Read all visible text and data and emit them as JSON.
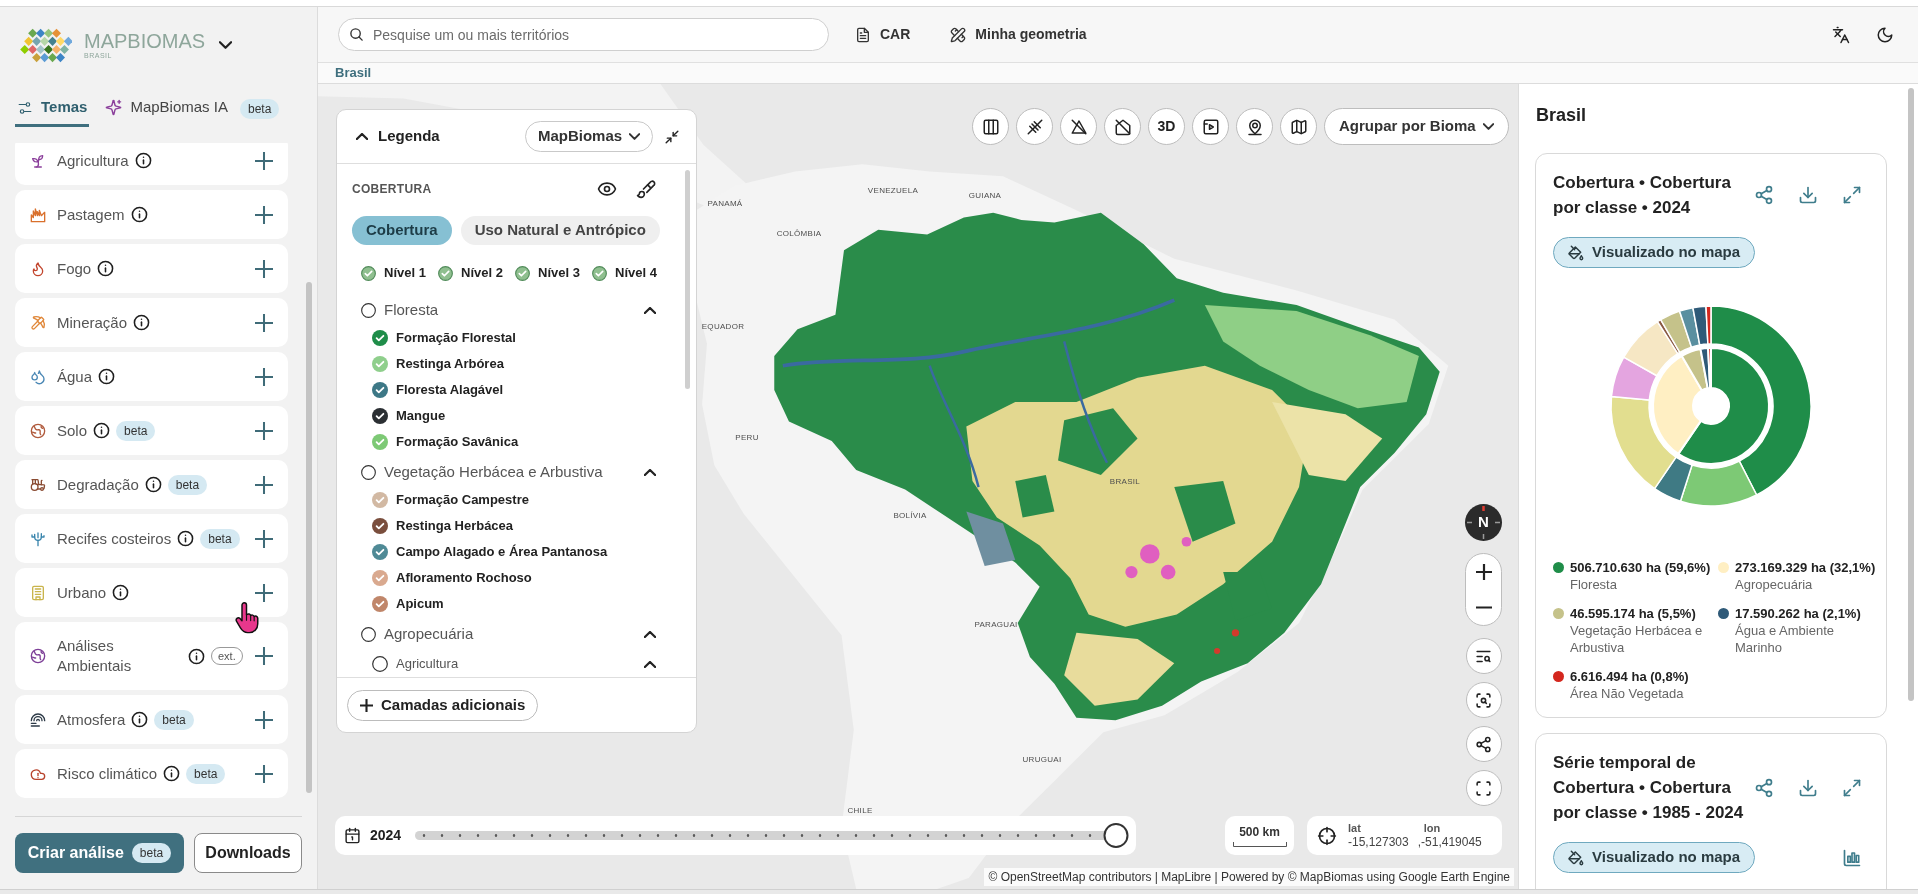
{
  "sidebar": {
    "logo": {
      "wordmark": "MAPBIOMAS",
      "country": "BRASIL"
    },
    "tabs": [
      {
        "label": "Temas",
        "selected": true
      },
      {
        "label": "MapBiomas IA",
        "selected": false,
        "badge": "beta"
      }
    ],
    "themes": [
      {
        "label": "Agricultura",
        "info": true
      },
      {
        "label": "Pastagem",
        "info": true
      },
      {
        "label": "Fogo",
        "info": true
      },
      {
        "label": "Mineração",
        "info": true
      },
      {
        "label": "Água",
        "info": true
      },
      {
        "label": "Solo",
        "info": true,
        "badge": {
          "kind": "filled",
          "text": "beta"
        }
      },
      {
        "label": "Degradação",
        "info": true,
        "badge": {
          "kind": "filled",
          "text": "beta"
        }
      },
      {
        "label": "Recifes costeiros",
        "info": true,
        "badge": {
          "kind": "filled",
          "text": "beta"
        }
      },
      {
        "label": "Urbano",
        "info": true
      },
      {
        "label": "Análises Ambientais",
        "info": true,
        "badge": {
          "kind": "outline",
          "text": "ext."
        }
      },
      {
        "label": "Atmosfera",
        "info": true,
        "badge": {
          "kind": "filled",
          "text": "beta"
        }
      },
      {
        "label": "Risco climático",
        "info": true,
        "badge": {
          "kind": "filled",
          "text": "beta"
        }
      }
    ],
    "actions": [
      {
        "kind": "primary",
        "label": "Criar análise",
        "badge": "beta"
      },
      {
        "kind": "secondary",
        "label": "Downloads"
      }
    ]
  },
  "topbar": {
    "search": {
      "placeholder": "Pesquise um ou mais territórios"
    },
    "links": [
      "CAR",
      "Minha geometria"
    ]
  },
  "breadcrumb": [
    "Brasil"
  ],
  "map": {
    "labels": [
      "PANAMÁ",
      "VENEZUELA",
      "GUIANA",
      "COLÔMBIA",
      "EQUADOR",
      "PERU",
      "BOLÍVIA",
      "BRASIL",
      "PARAGUAI",
      "URUGUAI",
      "CHILE"
    ],
    "legend": {
      "title": "Legenda",
      "expanded": true,
      "source": "MapBiomas",
      "section": "COBERTURA",
      "tabs": [
        {
          "label": "Cobertura",
          "selected": true
        },
        {
          "label": "Uso Natural e Antrópico",
          "selected": false
        }
      ],
      "levels": [
        {
          "label": "Nível 1",
          "checked": true
        },
        {
          "label": "Nível 2",
          "checked": true
        },
        {
          "label": "Nível 3",
          "checked": true
        },
        {
          "label": "Nível 4",
          "checked": true
        }
      ],
      "classes": [
        {
          "label": "Floresta",
          "checked": false,
          "expanded": true,
          "children": [
            {
              "label": "Formação Florestal",
              "checked": true,
              "color": "#1f8d49"
            },
            {
              "label": "Restinga Arbórea",
              "checked": true,
              "color": "#8fcf8c"
            },
            {
              "label": "Floresta Alagável",
              "checked": true,
              "color": "#3d7886"
            },
            {
              "label": "Mangue",
              "checked": true,
              "color": "#2b2f33"
            },
            {
              "label": "Formação Savânica",
              "checked": true,
              "color": "#7dc975"
            }
          ]
        },
        {
          "label": "Vegetação Herbácea e Arbustiva",
          "checked": false,
          "expanded": true,
          "children": [
            {
              "label": "Formação Campestre",
              "checked": true,
              "color": "#d2b9a3"
            },
            {
              "label": "Restinga Herbácea",
              "checked": true,
              "color": "#7a4e3d"
            },
            {
              "label": "Campo Alagado e Área Pantanosa",
              "checked": true,
              "color": "#4f8a96"
            },
            {
              "label": "Afloramento Rochoso",
              "checked": true,
              "color": "#d9a98f"
            },
            {
              "label": "Apicum",
              "checked": true,
              "color": "#c0866a"
            }
          ]
        },
        {
          "label": "Agropecuária",
          "checked": false,
          "expanded": true,
          "children": [
            {
              "label": "Agricultura",
              "checked": false,
              "expanded": true
            }
          ]
        }
      ],
      "add_button": "Camadas adicionais"
    },
    "toolbar": {
      "buttons": [
        {
          "kind": "icon"
        },
        {
          "kind": "icon"
        },
        {
          "kind": "icon"
        },
        {
          "kind": "icon"
        },
        {
          "kind": "text",
          "label": "3D"
        },
        {
          "kind": "icon"
        },
        {
          "kind": "icon"
        },
        {
          "kind": "icon"
        }
      ],
      "group_by": "Agrupar por Bioma"
    },
    "compass": "N",
    "timeline": {
      "year": "2024",
      "level": 1
    },
    "scale": "500 km",
    "coordinates": {
      "lat_label": "lat",
      "lat": "-15,127303",
      "lon_label": "lon",
      "lon": ",-51,419045"
    },
    "attribution": "© OpenStreetMap contributors | MapLibre | Powered by © MapBiomas using Google Earth Engine"
  },
  "panel": {
    "title": "Brasil",
    "cards": [
      {
        "kind": "snapshot",
        "title": "Cobertura • Cobertura por classe • 2024",
        "toggle": "Visualizado no mapa",
        "chart_data": {
          "type": "donut",
          "series": [
            {
              "values": [
                59.6,
                32.1,
                5.5,
                2.1,
                0.8
              ],
              "colors": [
                "#1f8d49",
                "#ffefc3",
                "#c5c28a",
                "#2f5a78",
                "#d4271e"
              ]
            },
            {
              "values": [
                42.5,
                12.5,
                4.6,
                17.0,
                6.6,
                7.9,
                0.6,
                3.3,
                2.2,
                2.1,
                0.8
              ],
              "colors": [
                "#1f8d49",
                "#7dc975",
                "#3f7a84",
                "#e2de8f",
                "#e4a5e0",
                "#f6e7c4",
                "#8a5a44",
                "#c5c28a",
                "#5a8fa0",
                "#2f5a78",
                "#d4271e"
              ]
            }
          ]
        },
        "legend": [
          {
            "value": "506.710.630 ha (59,6%)",
            "label": "Floresta",
            "color": "#1f8d49"
          },
          {
            "value": "273.169.329 ha (32,1%)",
            "label": "Agropecuária",
            "color": "#ffefc3"
          },
          {
            "value": "46.595.174 ha (5,5%)",
            "label": "Vegetação Herbácea e Arbustiva",
            "color": "#c5c28a"
          },
          {
            "value": "17.590.262 ha (2,1%)",
            "label": "Água e Ambiente Marinho",
            "color": "#2f5a78"
          },
          {
            "value": "6.616.494 ha (0,8%)",
            "label": "Área Não Vegetada",
            "color": "#d4271e"
          }
        ]
      },
      {
        "kind": "timeseries",
        "title": "Série temporal de Cobertura • Cobertura por classe • 1985 - 2024",
        "toggle": "Visualizado no mapa"
      }
    ]
  }
}
